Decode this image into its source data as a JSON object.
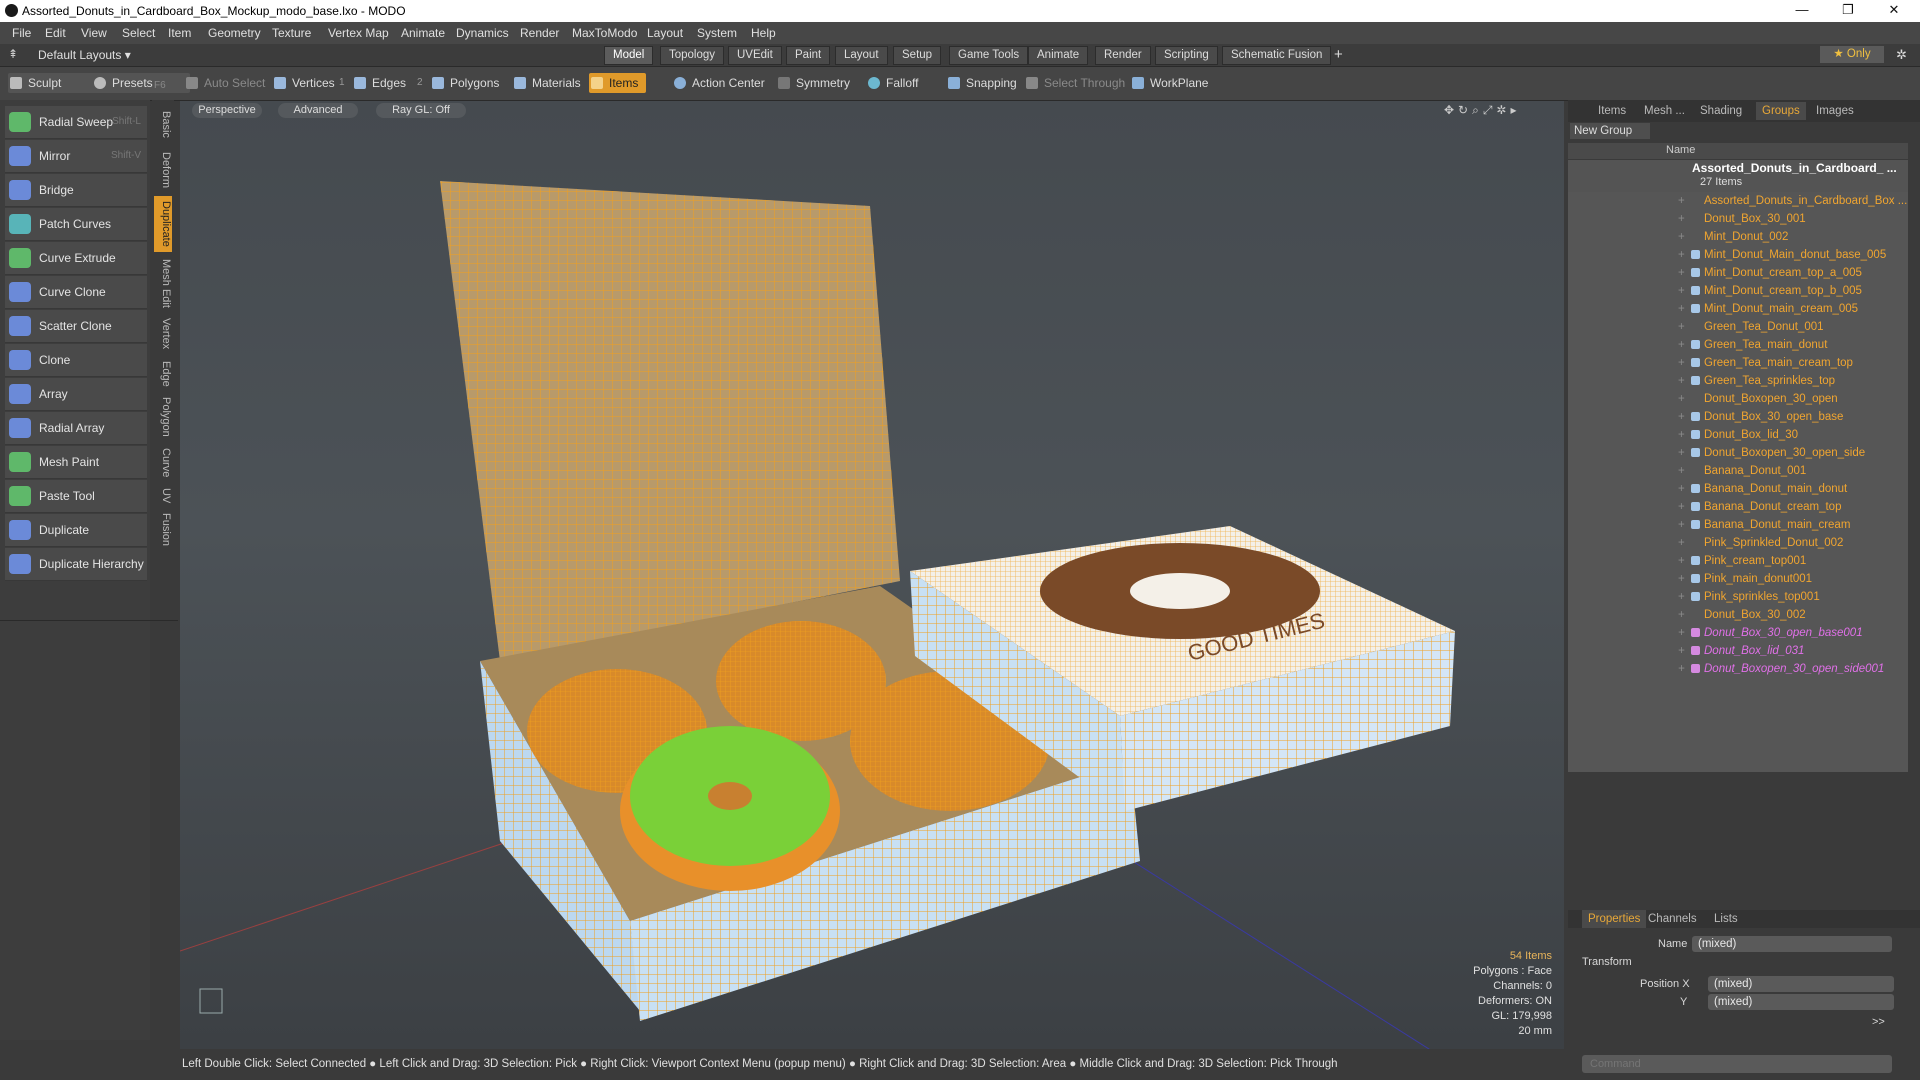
{
  "window": {
    "title": "Assorted_Donuts_in_Cardboard_Box_Mockup_modo_base.lxo - MODO",
    "minimize": "—",
    "restore": "❐",
    "close": "✕"
  },
  "menubar": [
    "File",
    "Edit",
    "View",
    "Select",
    "Item",
    "Geometry",
    "Texture",
    "Vertex Map",
    "Animate",
    "Dynamics",
    "Render",
    "MaxToModo",
    "Layout",
    "System",
    "Help"
  ],
  "layoutbar": {
    "layouts_label": "Default Layouts ▾",
    "tabs": [
      "Model",
      "Topology",
      "UVEdit",
      "Paint",
      "Layout",
      "Setup",
      "Game Tools",
      "Animate",
      "Render",
      "Scripting",
      "Schematic Fusion"
    ],
    "active_tab": "Model",
    "add": "+",
    "only_label": "★ Only",
    "gear": "✲"
  },
  "toolbar": {
    "sculpt": "Sculpt",
    "presets": "Presets",
    "presets_shortcut": "F6",
    "auto_select": "Auto Select",
    "vertices": "Vertices",
    "vertices_count": "1",
    "edges": "Edges",
    "edges_count": "2",
    "polygons": "Polygons",
    "materials": "Materials",
    "items": "Items",
    "action_center": "Action Center",
    "symmetry": "Symmetry",
    "falloff": "Falloff",
    "snapping": "Snapping",
    "select_through": "Select Through",
    "workplane": "WorkPlane"
  },
  "tools": [
    {
      "label": "Radial Sweep",
      "shortcut": "Shift-L",
      "color": "#5fb86a"
    },
    {
      "label": "Mirror",
      "shortcut": "Shift-V",
      "color": "#6b8ad8"
    },
    {
      "label": "Bridge",
      "shortcut": "",
      "color": "#6b8ad8"
    },
    {
      "label": "Patch Curves",
      "shortcut": "",
      "color": "#58b4b8"
    },
    {
      "label": "Curve Extrude",
      "shortcut": "",
      "color": "#5fb86a"
    },
    {
      "label": "Curve Clone",
      "shortcut": "",
      "color": "#6b8ad8"
    },
    {
      "label": "Scatter Clone",
      "shortcut": "",
      "color": "#6b8ad8"
    },
    {
      "label": "Clone",
      "shortcut": "",
      "color": "#6b8ad8"
    },
    {
      "label": "Array",
      "shortcut": "",
      "color": "#6b8ad8"
    },
    {
      "label": "Radial Array",
      "shortcut": "",
      "color": "#6b8ad8"
    },
    {
      "label": "Mesh Paint",
      "shortcut": "",
      "color": "#5fb86a"
    },
    {
      "label": "Paste Tool",
      "shortcut": "",
      "color": "#5fb86a"
    },
    {
      "label": "Duplicate",
      "shortcut": "",
      "color": "#6b8ad8"
    },
    {
      "label": "Duplicate Hierarchy",
      "shortcut": "",
      "color": "#6b8ad8"
    }
  ],
  "vtabs": [
    "Basic",
    "Deform",
    "Duplicate",
    "Mesh Edit",
    "Vertex",
    "Edge",
    "Polygon",
    "Curve",
    "UV",
    "Fusion"
  ],
  "vtab_active": "Duplicate",
  "viewport": {
    "perspective": "Perspective",
    "advanced": "Advanced",
    "raygl": "Ray GL: Off",
    "stats": {
      "items": "54 Items",
      "polygons": "Polygons : Face",
      "channels": "Channels: 0",
      "deformers": "Deformers: ON",
      "gl": "GL: 179,998",
      "size": "20 mm"
    },
    "box_lid_text": "GOOD TIMES"
  },
  "rightpanel": {
    "tabs": [
      "Items",
      "Mesh ...",
      "Shading",
      "Groups",
      "Images"
    ],
    "active_tab": "Groups",
    "new_group": "New Group",
    "name_col": "Name",
    "group_name": "Assorted_Donuts_in_Cardboard_ ...",
    "group_count": "27 Items",
    "rows": [
      {
        "name": "Assorted_Donuts_in_Cardboard_Box ...",
        "italic": false,
        "icon": false
      },
      {
        "name": "Donut_Box_30_001",
        "italic": false,
        "icon": false
      },
      {
        "name": "Mint_Donut_002",
        "italic": false,
        "icon": false
      },
      {
        "name": "Mint_Donut_Main_donut_base_005",
        "italic": false,
        "icon": true
      },
      {
        "name": "Mint_Donut_cream_top_a_005",
        "italic": false,
        "icon": true
      },
      {
        "name": "Mint_Donut_cream_top_b_005",
        "italic": false,
        "icon": true
      },
      {
        "name": "Mint_Donut_main_cream_005",
        "italic": false,
        "icon": true
      },
      {
        "name": "Green_Tea_Donut_001",
        "italic": false,
        "icon": false
      },
      {
        "name": "Green_Tea_main_donut",
        "italic": false,
        "icon": true
      },
      {
        "name": "Green_Tea_main_cream_top",
        "italic": false,
        "icon": true
      },
      {
        "name": "Green_Tea_sprinkles_top",
        "italic": false,
        "icon": true
      },
      {
        "name": "Donut_Boxopen_30_open",
        "italic": false,
        "icon": false
      },
      {
        "name": "Donut_Box_30_open_base",
        "italic": false,
        "icon": true
      },
      {
        "name": "Donut_Box_lid_30",
        "italic": false,
        "icon": true
      },
      {
        "name": "Donut_Boxopen_30_open_side",
        "italic": false,
        "icon": true
      },
      {
        "name": "Banana_Donut_001",
        "italic": false,
        "icon": false
      },
      {
        "name": "Banana_Donut_main_donut",
        "italic": false,
        "icon": true
      },
      {
        "name": "Banana_Donut_cream_top",
        "italic": false,
        "icon": true
      },
      {
        "name": "Banana_Donut_main_cream",
        "italic": false,
        "icon": true
      },
      {
        "name": "Pink_Sprinkled_Donut_002",
        "italic": false,
        "icon": false
      },
      {
        "name": "Pink_cream_top001",
        "italic": false,
        "icon": true
      },
      {
        "name": "Pink_main_donut001",
        "italic": false,
        "icon": true
      },
      {
        "name": "Pink_sprinkles_top001",
        "italic": false,
        "icon": true
      },
      {
        "name": "Donut_Box_30_002",
        "italic": false,
        "icon": false
      },
      {
        "name": "Donut_Box_30_open_base001",
        "italic": true,
        "icon": true
      },
      {
        "name": "Donut_Box_lid_031",
        "italic": true,
        "icon": true
      },
      {
        "name": "Donut_Boxopen_30_open_side001",
        "italic": true,
        "icon": true
      }
    ],
    "props_tabs": [
      "Properties",
      "Channels",
      "Lists"
    ],
    "props_active": "Properties",
    "name_label": "Name",
    "name_value": "(mixed)",
    "transform": "Transform",
    "position_x_label": "Position X",
    "position_x": "(mixed)",
    "y_label": "Y",
    "position_y": "(mixed)",
    "expand": ">>",
    "command_placeholder": "Command"
  },
  "statusbar": "Left Double Click: Select Connected ● Left Click and Drag: 3D Selection: Pick ● Right Click: Viewport Context Menu (popup menu) ● Right Click and Drag: 3D Selection: Area ● Middle Click and Drag: 3D Selection: Pick Through"
}
